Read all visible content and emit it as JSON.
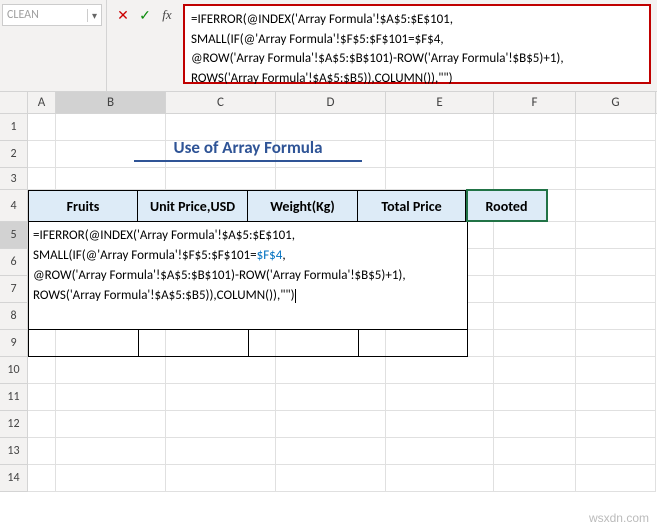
{
  "nameBox": {
    "value": "CLEAN"
  },
  "formulaBar": {
    "line1": "=IFERROR(@INDEX('Array Formula'!$A$5:$E$101,",
    "line2": "SMALL(IF(@'Array Formula'!$F$5:$F$101=$F$4,",
    "line3": "@ROW('Array Formula'!$A$5:$B$101)-ROW('Array Formula'!$B$5)+1),",
    "line4": "ROWS('Array Formula'!$A$5:$B5)),COLUMN()),\"\")"
  },
  "columns": {
    "A": "A",
    "B": "B",
    "C": "C",
    "D": "D",
    "E": "E",
    "F": "F",
    "G": "G"
  },
  "rows": [
    "1",
    "2",
    "3",
    "4",
    "5",
    "6",
    "7",
    "8",
    "9",
    "10",
    "11",
    "12",
    "13",
    "14"
  ],
  "title": "Use of Array Formula",
  "headers": {
    "fruits": "Fruits",
    "unitPrice": "Unit Price,USD",
    "weight": "Weight(Kg)",
    "totalPrice": "Total Price",
    "rooted": "Rooted"
  },
  "editing": {
    "line1_pre": "=IFERROR(@INDEX('Array Formula'!$A$5:$E$101,",
    "line2_pre": "SMALL(IF(@'Array Formula'!$F$5:$F$101=",
    "line2_ref": "$F$4",
    "line2_post": ",",
    "line3": "@ROW('Array Formula'!$A$5:$B$101)-ROW('Array Formula'!$B$5)+1),",
    "line4": "ROWS('Array Formula'!$A$5:$B5)),COLUMN()),\"\")"
  },
  "watermark": "wsxdn.com"
}
